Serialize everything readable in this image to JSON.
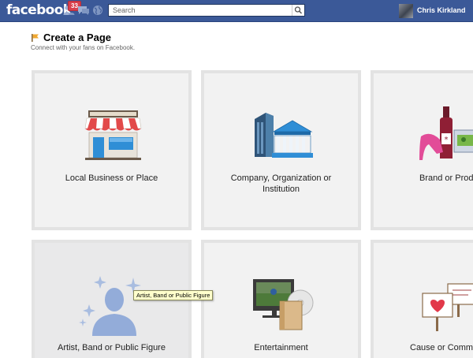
{
  "topbar": {
    "logo": "facebook",
    "notifications_count": "33",
    "search_placeholder": "Search",
    "user_name": "Chris Kirkland"
  },
  "header": {
    "title": "Create a Page",
    "subtitle": "Connect with your fans on Facebook."
  },
  "categories": [
    {
      "label": "Local Business or Place",
      "icon": "storefront-icon"
    },
    {
      "label": "Company, Organization or Institution",
      "icon": "buildings-icon"
    },
    {
      "label": "Brand or Product",
      "icon": "products-icon"
    },
    {
      "label": "Artist, Band or Public Figure",
      "icon": "person-silhouette-icon"
    },
    {
      "label": "Entertainment",
      "icon": "tv-media-icon"
    },
    {
      "label": "Cause or Community",
      "icon": "signs-icon"
    }
  ],
  "tooltip": "Artist, Band or Public Figure",
  "colors": {
    "topbar": "#3b5998",
    "tile_bg": "#f2f2f2",
    "tile_border": "#e3e3e3"
  }
}
